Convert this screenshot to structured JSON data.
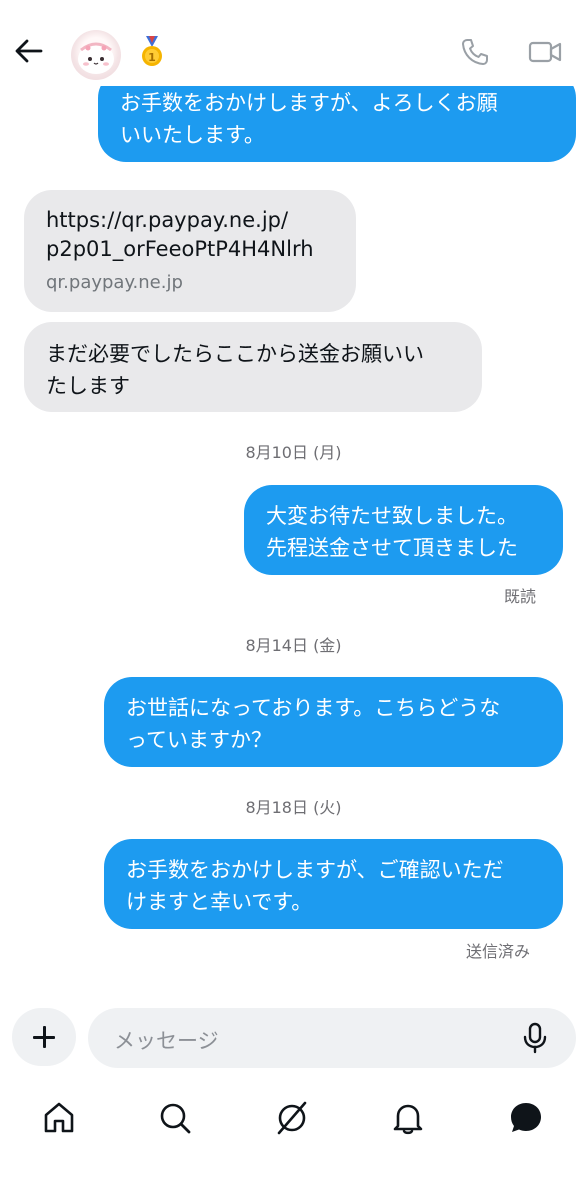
{
  "header": {
    "back_icon": "arrow-left-icon",
    "avatar_icon": "pink-character-avatar",
    "badge_icon": "gold-medal-icon",
    "call_icon": "phone-icon",
    "video_icon": "video-camera-icon"
  },
  "messages": [
    {
      "side": "out",
      "lines": [
        "お手数をおかけしますが、よろしくお願",
        "いいたします。"
      ]
    },
    {
      "side": "in",
      "link_url_lines": [
        "https://qr.paypay.ne.jp/",
        "p2p01_orFeeoPtP4H4Nlrh"
      ],
      "link_domain": "qr.paypay.ne.jp"
    },
    {
      "side": "in",
      "lines": [
        "まだ必要でしたらここから送金お願いい",
        "たします"
      ]
    },
    {
      "side": "out",
      "lines": [
        "大変お待たせ致しました。",
        "先程送金させて頂きました"
      ]
    },
    {
      "side": "out",
      "lines": [
        "お世話になっております。こちらどうな",
        "っていますか？"
      ]
    },
    {
      "side": "out",
      "lines": [
        "お手数をおかけしますが、ご確認いただ",
        "けますと幸いです。"
      ]
    }
  ],
  "dates": [
    "8月10日 (月)",
    "8月14日 (金)",
    "8月18日 (火)"
  ],
  "status": {
    "read": "既読",
    "sent": "送信済み"
  },
  "composer": {
    "placeholder": "メッセージ",
    "add_icon": "plus-icon",
    "mic_icon": "microphone-icon"
  },
  "nav": [
    "home-icon",
    "search-icon",
    "explore-icon",
    "notifications-bell-icon",
    "messages-icon"
  ],
  "colors": {
    "outgoing_bubble": "#1d9bf0",
    "incoming_bubble": "#e9e9eb",
    "muted_text": "#6e6e73"
  }
}
